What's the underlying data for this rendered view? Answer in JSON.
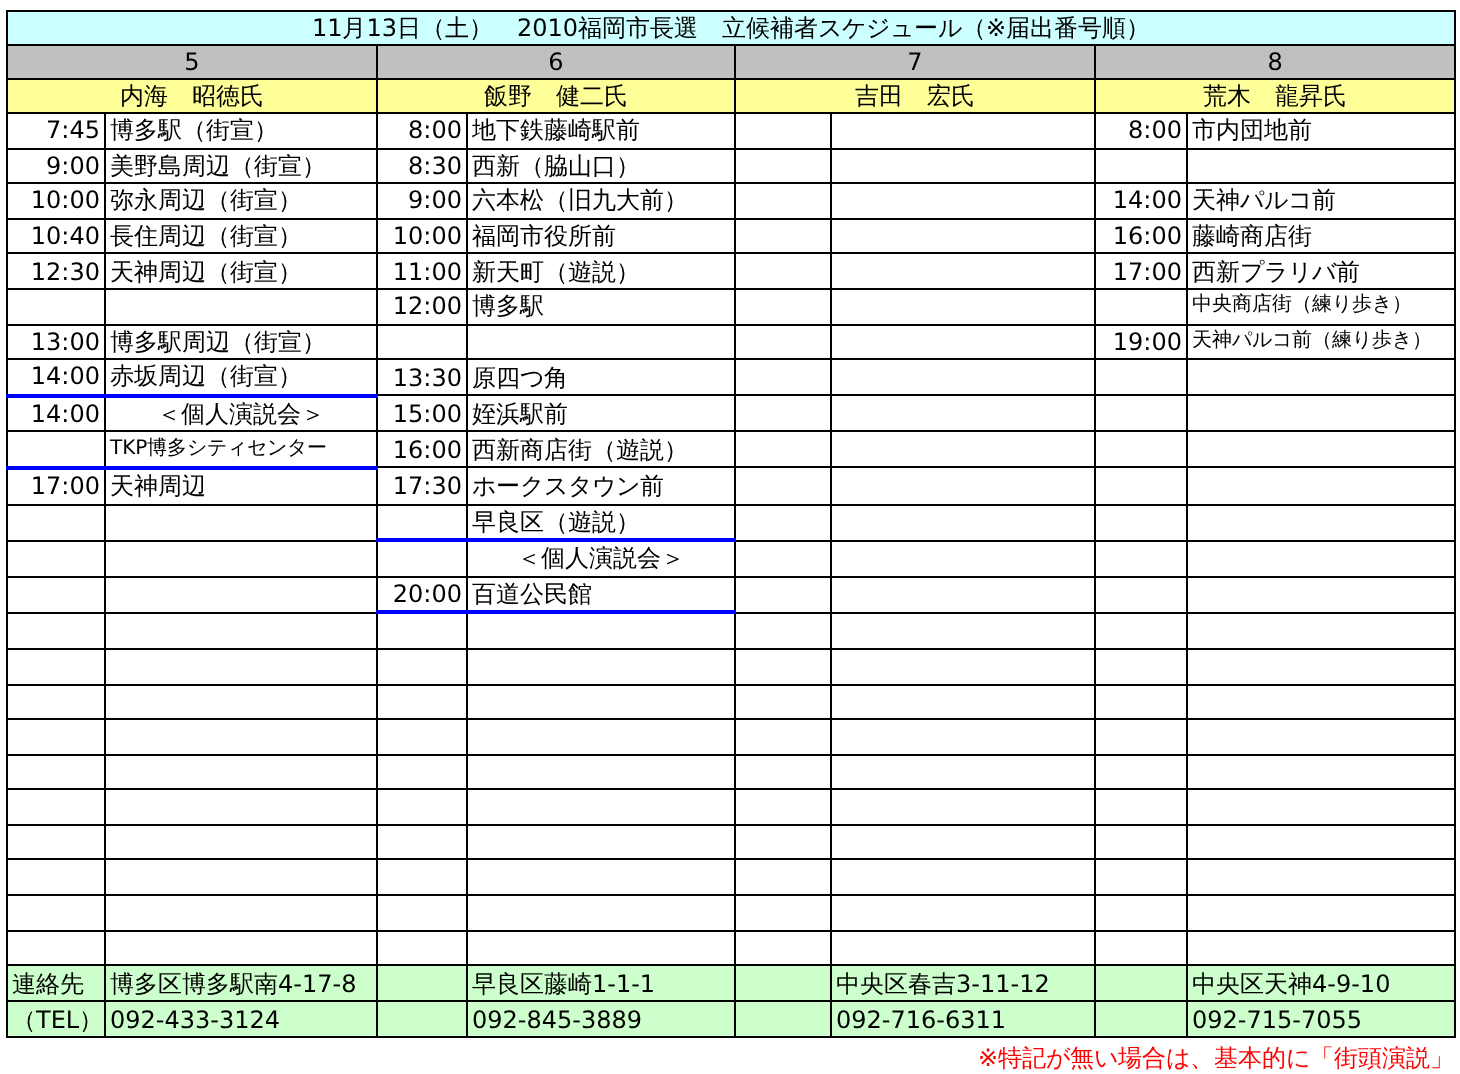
{
  "title": "11月13日（土）　2010福岡市長選　立候補者スケジュール（※届出番号順）",
  "candidates": [
    {
      "number": "5",
      "name": "内海　昭徳氏",
      "entries": [
        {
          "time": "7:45",
          "place": "博多駅（街宣）",
          "kind": "normal"
        },
        {
          "time": "9:00",
          "place": "美野島周辺（街宣）",
          "kind": "normal"
        },
        {
          "time": "10:00",
          "place": "弥永周辺（街宣）",
          "kind": "normal"
        },
        {
          "time": "10:40",
          "place": "長住周辺（街宣）",
          "kind": "normal"
        },
        {
          "time": "12:30",
          "place": "天神周辺（街宣）",
          "kind": "normal"
        },
        {
          "kind": "normal"
        },
        {
          "time": "13:00",
          "place": "博多駅周辺（街宣）",
          "kind": "normal"
        },
        {
          "time": "14:00",
          "place": "赤坂周辺（街宣）",
          "kind": "normal",
          "rule": true
        },
        {
          "time": "14:00",
          "place": "＜個人演説会＞",
          "kind": "center"
        },
        {
          "place": "TKP博多シティセンター",
          "kind": "small",
          "rule": true
        },
        {
          "time": "17:00",
          "place": "天神周辺",
          "kind": "normal"
        }
      ]
    },
    {
      "number": "6",
      "name": "飯野　健二氏",
      "entries": [
        {
          "time": "8:00",
          "place": "地下鉄藤崎駅前",
          "kind": "normal"
        },
        {
          "time": "8:30",
          "place": "西新（脇山口）",
          "kind": "normal"
        },
        {
          "time": "9:00",
          "place": "六本松（旧九大前）",
          "kind": "normal"
        },
        {
          "time": "10:00",
          "place": "福岡市役所前",
          "kind": "normal"
        },
        {
          "time": "11:00",
          "place": "新天町（遊説）",
          "kind": "normal"
        },
        {
          "time": "12:00",
          "place": "博多駅",
          "kind": "normal"
        },
        {
          "kind": "normal"
        },
        {
          "time": "13:30",
          "place": "原四つ角",
          "kind": "normal"
        },
        {
          "time": "15:00",
          "place": "姪浜駅前",
          "kind": "normal"
        },
        {
          "time": "16:00",
          "place": "西新商店街（遊説）",
          "kind": "normal"
        },
        {
          "time": "17:30",
          "place": "ホークスタウン前",
          "kind": "normal"
        },
        {
          "place": "早良区（遊説）",
          "kind": "normal",
          "rule": true
        },
        {
          "place": "＜個人演説会＞",
          "kind": "center"
        },
        {
          "time": "20:00",
          "place": "百道公民館",
          "kind": "normal",
          "rule": true
        }
      ]
    },
    {
      "number": "7",
      "name": "吉田　宏氏"
    },
    {
      "number": "8",
      "name": "荒木　龍昇氏",
      "entries": [
        {
          "time": "8:00",
          "place": "市内団地前",
          "kind": "normal"
        },
        {
          "kind": "normal"
        },
        {
          "time": "14:00",
          "place": "天神パルコ前",
          "kind": "normal"
        },
        {
          "time": "16:00",
          "place": "藤崎商店街",
          "kind": "normal"
        },
        {
          "time": "17:00",
          "place": "西新プラリバ前",
          "kind": "normal"
        },
        {
          "place": "中央商店街（練り歩き）",
          "kind": "small"
        },
        {
          "time": "19:00",
          "place": "天神パルコ前（練り歩き）",
          "kind": "small"
        }
      ]
    }
  ],
  "footer": [
    {
      "label": "連絡先",
      "values": [
        "博多区博多駅南4-17-8",
        "早良区藤崎1-1-1",
        "中央区春吉3-11-12",
        "中央区天神4-9-10"
      ]
    },
    {
      "label": "（TEL）",
      "values": [
        "092-433-3124",
        "092-845-3889",
        "092-716-6311",
        "092-715-7055"
      ]
    }
  ],
  "note": "※特記が無い場合は、基本的に「街頭演説」"
}
